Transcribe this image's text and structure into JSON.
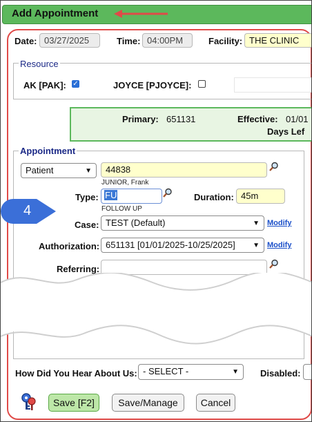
{
  "window": {
    "title": "Add Appointment"
  },
  "header": {
    "date_label": "Date:",
    "date_value": "03/27/2025",
    "time_label": "Time:",
    "time_value": "04:00PM",
    "facility_label": "Facility:",
    "facility_value": "THE CLINIC"
  },
  "resource": {
    "legend": "Resource",
    "items": [
      {
        "label": "AK [PAK]:",
        "checked": true
      },
      {
        "label": "JOYCE [PJOYCE]:",
        "checked": false
      }
    ]
  },
  "insurance": {
    "primary_label": "Primary:",
    "primary_value": "651131",
    "effective_label": "Effective:",
    "effective_value": "01/01",
    "days_left_label": "Days Lef"
  },
  "appointment": {
    "legend": "Appointment",
    "patient_type": "Patient",
    "patient_id": "44838",
    "patient_name": "JUNIOR, Frank",
    "step_number": "4",
    "type_label": "Type:",
    "type_value": "FU",
    "type_desc": "FOLLOW UP",
    "duration_label": "Duration:",
    "duration_value": "45m",
    "case_label": "Case:",
    "case_value": "TEST (Default)",
    "case_modify": "Modify",
    "auth_label": "Authorization:",
    "auth_value": "651131 [01/01/2025-10/25/2025]",
    "auth_modify": "Modify",
    "referring_label": "Referring:",
    "referring_value": ""
  },
  "footer": {
    "hear_label": "How Did You Hear About Us:",
    "hear_value": "- SELECT -",
    "disabled_label": "Disabled:",
    "buttons": {
      "save": "Save [F2]",
      "save_manage": "Save/Manage",
      "cancel": "Cancel"
    }
  },
  "colors": {
    "title_bar": "#5cb85c",
    "highlight": "#e04a48",
    "step_badge": "#3b6fd8",
    "field_yellow": "#ffffcc"
  },
  "icons": [
    "magnifier-icon",
    "keys-icon",
    "arrow-left-icon",
    "checkmark-icon",
    "chevron-down-icon"
  ]
}
